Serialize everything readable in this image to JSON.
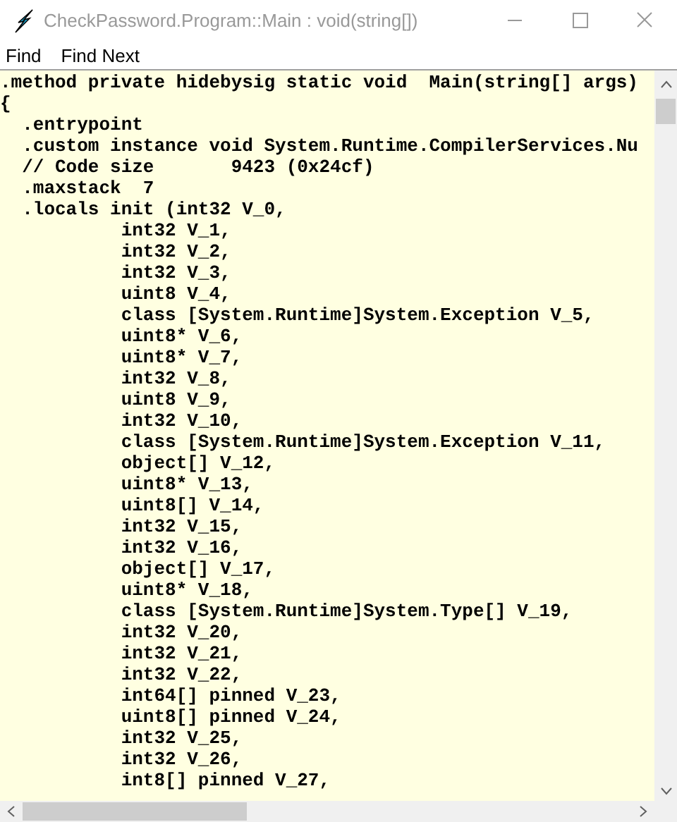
{
  "window": {
    "title": "CheckPassword.Program::Main : void(string[])"
  },
  "menu": [
    "Find",
    "Find Next"
  ],
  "code_lines": [
    ".method private hidebysig static void  Main(string[] args)",
    "{",
    "  .entrypoint",
    "  .custom instance void System.Runtime.CompilerServices.Nu",
    "  // Code size       9423 (0x24cf)",
    "  .maxstack  7",
    "  .locals init (int32 V_0,",
    "           int32 V_1,",
    "           int32 V_2,",
    "           int32 V_3,",
    "           uint8 V_4,",
    "           class [System.Runtime]System.Exception V_5,",
    "           uint8* V_6,",
    "           uint8* V_7,",
    "           int32 V_8,",
    "           uint8 V_9,",
    "           int32 V_10,",
    "           class [System.Runtime]System.Exception V_11,",
    "           object[] V_12,",
    "           uint8* V_13,",
    "           uint8[] V_14,",
    "           int32 V_15,",
    "           int32 V_16,",
    "           object[] V_17,",
    "           uint8* V_18,",
    "           class [System.Runtime]System.Type[] V_19,",
    "           int32 V_20,",
    "           int32 V_21,",
    "           int32 V_22,",
    "           int64[] pinned V_23,",
    "           uint8[] pinned V_24,",
    "           int32 V_25,",
    "           int32 V_26,",
    "           int8[] pinned V_27,"
  ]
}
